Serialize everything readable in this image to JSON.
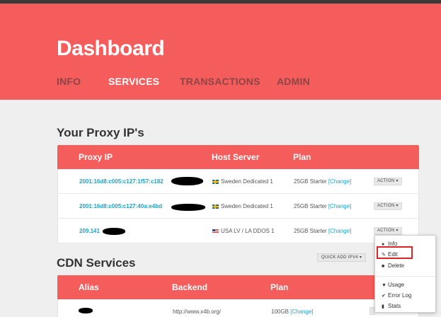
{
  "header": {
    "title": "Dashboard",
    "nav": [
      "INFO",
      "SERVICES",
      "TRANSACTIONS",
      "ADMIN"
    ],
    "active_nav": "SERVICES"
  },
  "proxy_section": {
    "title": "Your Proxy IP's",
    "columns": [
      "Proxy IP",
      "Host Server",
      "Plan"
    ],
    "rows": [
      {
        "ip": "2001:16d8:c005:c127:1f57:c182",
        "host": "Sweden Dedicated 1",
        "flag": "sweden-flag-icon",
        "plan": "25GB Starter",
        "change": "[Change]",
        "action": "ACTION"
      },
      {
        "ip": "2001:16d8:c005:c127:40a:e4bd",
        "host": "Sweden Dedicated 1",
        "flag": "sweden-flag-icon",
        "plan": "25GB Starter",
        "change": "[Change]",
        "action": "ACTION"
      },
      {
        "ip": "209.141",
        "host": "USA LV / LA DDOS 1",
        "flag": "usa-flag-icon",
        "plan": "25GB Starter",
        "change": "[Change]",
        "action": "ACTION"
      }
    ]
  },
  "cdn_section": {
    "title": "CDN Services",
    "quick_add": "QUICK ADD IPV4",
    "columns": [
      "Alias",
      "Backend",
      "Plan"
    ],
    "rows": [
      {
        "backend": "http://www.x4b.org/",
        "plan": "100GB",
        "change": "[Change]"
      }
    ]
  },
  "dropdown": {
    "items": [
      {
        "icon": "info-icon",
        "label": "Info"
      },
      {
        "icon": "pencil-icon",
        "label": "Edit"
      },
      {
        "icon": "trash-icon",
        "label": "Delete"
      },
      {
        "icon": "filter-icon",
        "label": "Usage"
      },
      {
        "icon": "check-icon",
        "label": "Error Log"
      },
      {
        "icon": "bar-chart-icon",
        "label": "Stats"
      }
    ],
    "highlighted": "Edit",
    "highlight_color": "#d72626"
  },
  "colors": {
    "brand": "#f55c5c",
    "link": "#1aa3c9",
    "nav_inactive": "#8e4545"
  }
}
